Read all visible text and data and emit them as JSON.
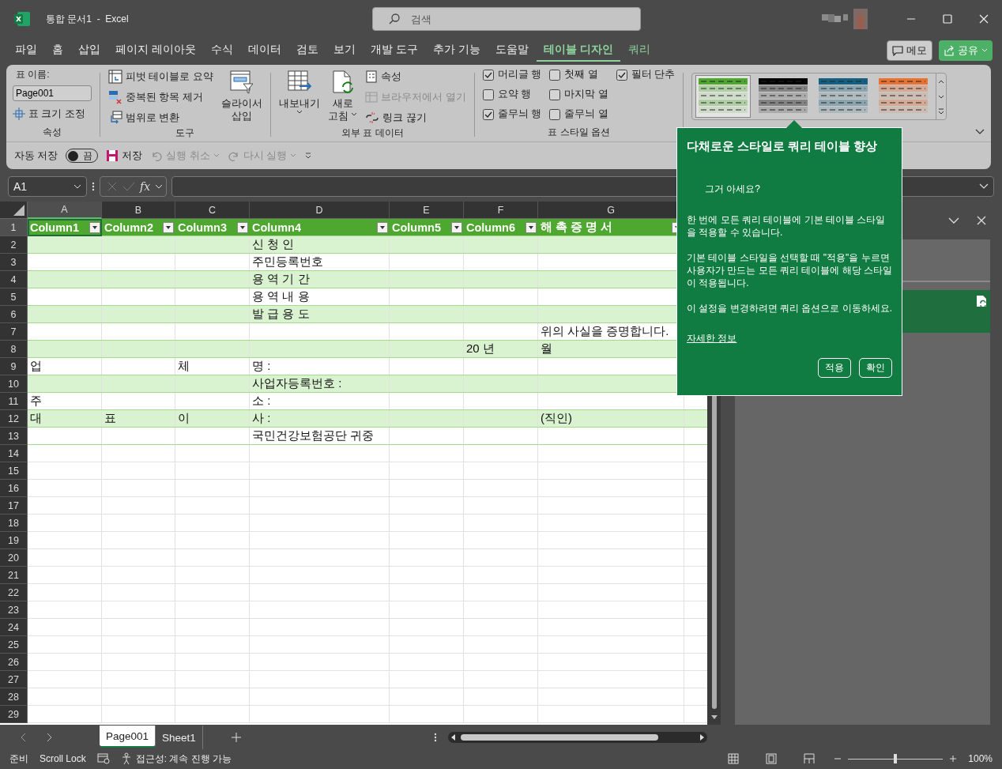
{
  "window": {
    "title": "통합 문서1  -  Excel",
    "search": {
      "placeholder": "검색"
    }
  },
  "menu_tabs": [
    {
      "label": "파일",
      "selected": false,
      "contextual": false
    },
    {
      "label": "홈",
      "selected": false,
      "contextual": false
    },
    {
      "label": "삽입",
      "selected": false,
      "contextual": false
    },
    {
      "label": "페이지 레이아웃",
      "selected": false,
      "contextual": false
    },
    {
      "label": "수식",
      "selected": false,
      "contextual": false
    },
    {
      "label": "데이터",
      "selected": false,
      "contextual": false
    },
    {
      "label": "검토",
      "selected": false,
      "contextual": false
    },
    {
      "label": "보기",
      "selected": false,
      "contextual": false
    },
    {
      "label": "개발 도구",
      "selected": false,
      "contextual": false
    },
    {
      "label": "추가 기능",
      "selected": false,
      "contextual": false
    },
    {
      "label": "도움말",
      "selected": false,
      "contextual": false
    },
    {
      "label": "테이블 디자인",
      "selected": true,
      "contextual": true
    },
    {
      "label": "쿼리",
      "selected": false,
      "contextual": true
    }
  ],
  "top_buttons": {
    "comments": "메모",
    "share": "공유"
  },
  "ribbon": {
    "properties": {
      "name_label": "표 이름:",
      "table_name": "Page001",
      "resize": "표 크기 조정",
      "group_label": "속성"
    },
    "tools": {
      "items": [
        {
          "label": "피벗 테이블로 요약",
          "kind": "pivot"
        },
        {
          "label": "중복된 항목 제거",
          "kind": "dedupe"
        },
        {
          "label": "범위로 변환",
          "kind": "convert"
        }
      ],
      "slicer": [
        "슬라이서",
        "삽입"
      ],
      "group_label": "도구"
    },
    "external": {
      "export": "내보내기",
      "refresh": [
        "새로",
        "고침"
      ],
      "items": [
        {
          "label": "속성",
          "kind": "props",
          "disabled": false
        },
        {
          "label": "브라우저에서 열기",
          "kind": "browser",
          "disabled": true
        },
        {
          "label": "링크 끊기",
          "kind": "unlink",
          "disabled": false
        }
      ],
      "group_label": "외부 표 데이터"
    },
    "style_options": {
      "columns": [
        [
          {
            "label": "머리글 행",
            "checked": true
          },
          {
            "label": "요약 행",
            "checked": false
          },
          {
            "label": "줄무늬 행",
            "checked": true
          }
        ],
        [
          {
            "label": "첫째 열",
            "checked": false
          },
          {
            "label": "마지막 열",
            "checked": false
          },
          {
            "label": "줄무늬 열",
            "checked": false
          }
        ],
        [
          {
            "label": "필터 단추",
            "checked": true
          }
        ]
      ],
      "group_label": "표 스타일 옵션"
    },
    "table_styles": [
      {
        "color": "#4ea72e",
        "selected": true
      },
      {
        "color": "#000000",
        "selected": false
      },
      {
        "color": "#156082",
        "selected": false
      },
      {
        "color": "#e97132",
        "selected": false
      }
    ]
  },
  "quick_access": {
    "autosave": "자동 저장",
    "toggle": {
      "label": "끔",
      "on": false
    },
    "save": "저장",
    "undo": {
      "label": "실행 취소",
      "disabled": true
    },
    "redo": {
      "label": "다시 실행",
      "disabled": true
    }
  },
  "formula_bar": {
    "name_box": "A1",
    "fx": "fx"
  },
  "sheet": {
    "columns": [
      "A",
      "B",
      "C",
      "D",
      "E",
      "F",
      "G"
    ],
    "header": [
      {
        "label": "Column1",
        "selected": true
      },
      {
        "label": "Column2",
        "selected": false
      },
      {
        "label": "Column3",
        "selected": false
      },
      {
        "label": "Column4",
        "selected": false
      },
      {
        "label": "Column5",
        "selected": false
      },
      {
        "label": "Column6",
        "selected": false
      },
      {
        "label": "해 촉 증 명 서",
        "selected": false
      }
    ],
    "rows": [
      {
        "number": "2",
        "cells": [
          "",
          "",
          "",
          "신 청 인",
          "",
          "",
          ""
        ]
      },
      {
        "number": "3",
        "cells": [
          "",
          "",
          "",
          "주민등록번호",
          "",
          "",
          ""
        ]
      },
      {
        "number": "4",
        "cells": [
          "",
          "",
          "",
          "용 역 기 간",
          "",
          "",
          ""
        ]
      },
      {
        "number": "5",
        "cells": [
          "",
          "",
          "",
          "용 역 내 용",
          "",
          "",
          ""
        ]
      },
      {
        "number": "6",
        "cells": [
          "",
          "",
          "",
          "발 급 용 도",
          "",
          "",
          ""
        ]
      },
      {
        "number": "7",
        "cells": [
          "",
          "",
          "",
          "",
          "",
          "",
          "위의 사실을 증명합니다."
        ]
      },
      {
        "number": "8",
        "cells": [
          "",
          "",
          "",
          "",
          "",
          "20 년",
          "월"
        ]
      },
      {
        "number": "9",
        "cells": [
          "업",
          "",
          "체",
          "명 :",
          "",
          "",
          ""
        ]
      },
      {
        "number": "10",
        "cells": [
          "",
          "",
          "",
          "사업자등록번호 :",
          "",
          "",
          ""
        ]
      },
      {
        "number": "11",
        "cells": [
          "주",
          "",
          "",
          "소 :",
          "",
          "",
          ""
        ]
      },
      {
        "number": "12",
        "cells": [
          "대",
          "표",
          "이",
          "사 :",
          "",
          "",
          "(직인)"
        ]
      },
      {
        "number": "13",
        "cells": [
          "",
          "",
          "",
          "국민건강보험공단 귀중",
          "",
          "",
          ""
        ]
      }
    ],
    "header_row_number": "1",
    "empty_rows": [
      "14",
      "15",
      "16",
      "17",
      "18",
      "19",
      "20",
      "21",
      "22",
      "23",
      "24",
      "25",
      "26",
      "27",
      "28",
      "29"
    ]
  },
  "sheet_tabs": [
    {
      "label": "Page001",
      "selected": true
    },
    {
      "label": "Sheet1",
      "selected": false
    }
  ],
  "status_bar": {
    "ready": "준비",
    "scroll_lock": "Scroll Lock",
    "accessibility": "접근성: 계속 진행 가능",
    "zoom": {
      "level": 0.5,
      "reading": "100%"
    }
  },
  "tooltip": {
    "title": "다채로운 스타일로 쿼리 테이블 향상",
    "subtitle": "그거 아세요?",
    "paragraphs": [
      "한 번에 모든 쿼리 테이블에 기본 테이블 스타일을 적용할 수 있습니다.",
      "기본 테이블 스타일을 선택할 때 \"적용\"을 누르면 사용자가 만드는 모든 쿼리 테이블에 해당 스타일이 적용됩니다.",
      "이 설정을 변경하려면 쿼리 옵션으로 이동하세요."
    ],
    "link": "자세한 정보",
    "buttons": [
      "적용",
      "확인"
    ]
  }
}
